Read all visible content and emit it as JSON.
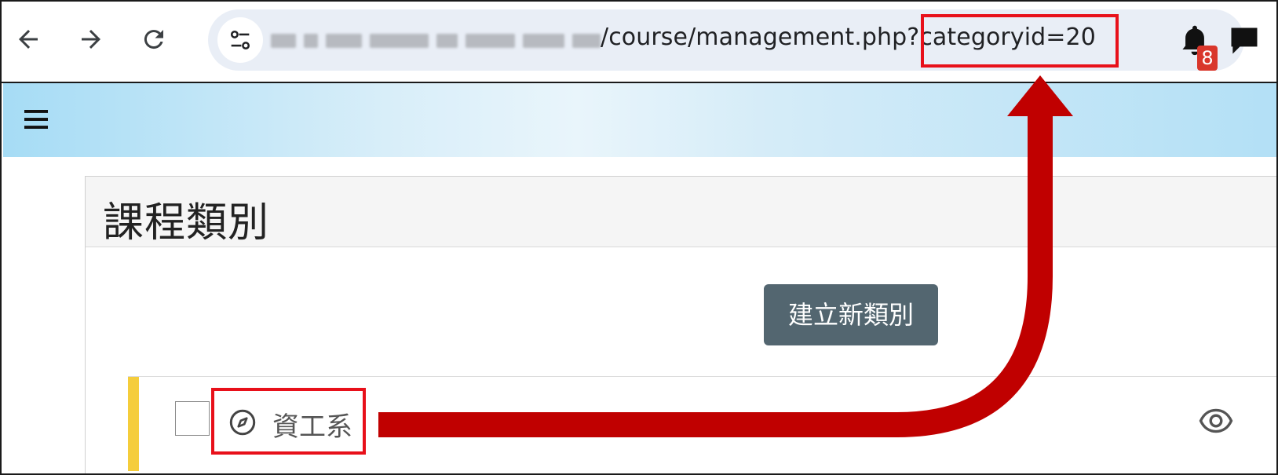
{
  "browser": {
    "url_visible": "/course/management.php?categoryid=20",
    "url_path_part": "/course/management.php",
    "url_query_part": "?categoryid=20"
  },
  "header": {
    "notification_count": "8"
  },
  "page": {
    "title": "課程類別",
    "create_button_label": "建立新類別"
  },
  "categories": [
    {
      "name": "資工系"
    }
  ],
  "colors": {
    "annotation_red": "#c00000",
    "highlight_border": "#e8101a",
    "button_bg": "#536670",
    "category_accent": "#f5cd3b",
    "badge": "#d9362b"
  },
  "icons": {
    "back": "arrow-left-icon",
    "forward": "arrow-right-icon",
    "reload": "reload-icon",
    "site_info": "tune-icon",
    "bookmark": "star-icon",
    "menu": "hamburger-icon",
    "notifications": "bell-icon",
    "messages": "chat-icon",
    "category": "compass-icon",
    "visibility": "eye-icon"
  }
}
